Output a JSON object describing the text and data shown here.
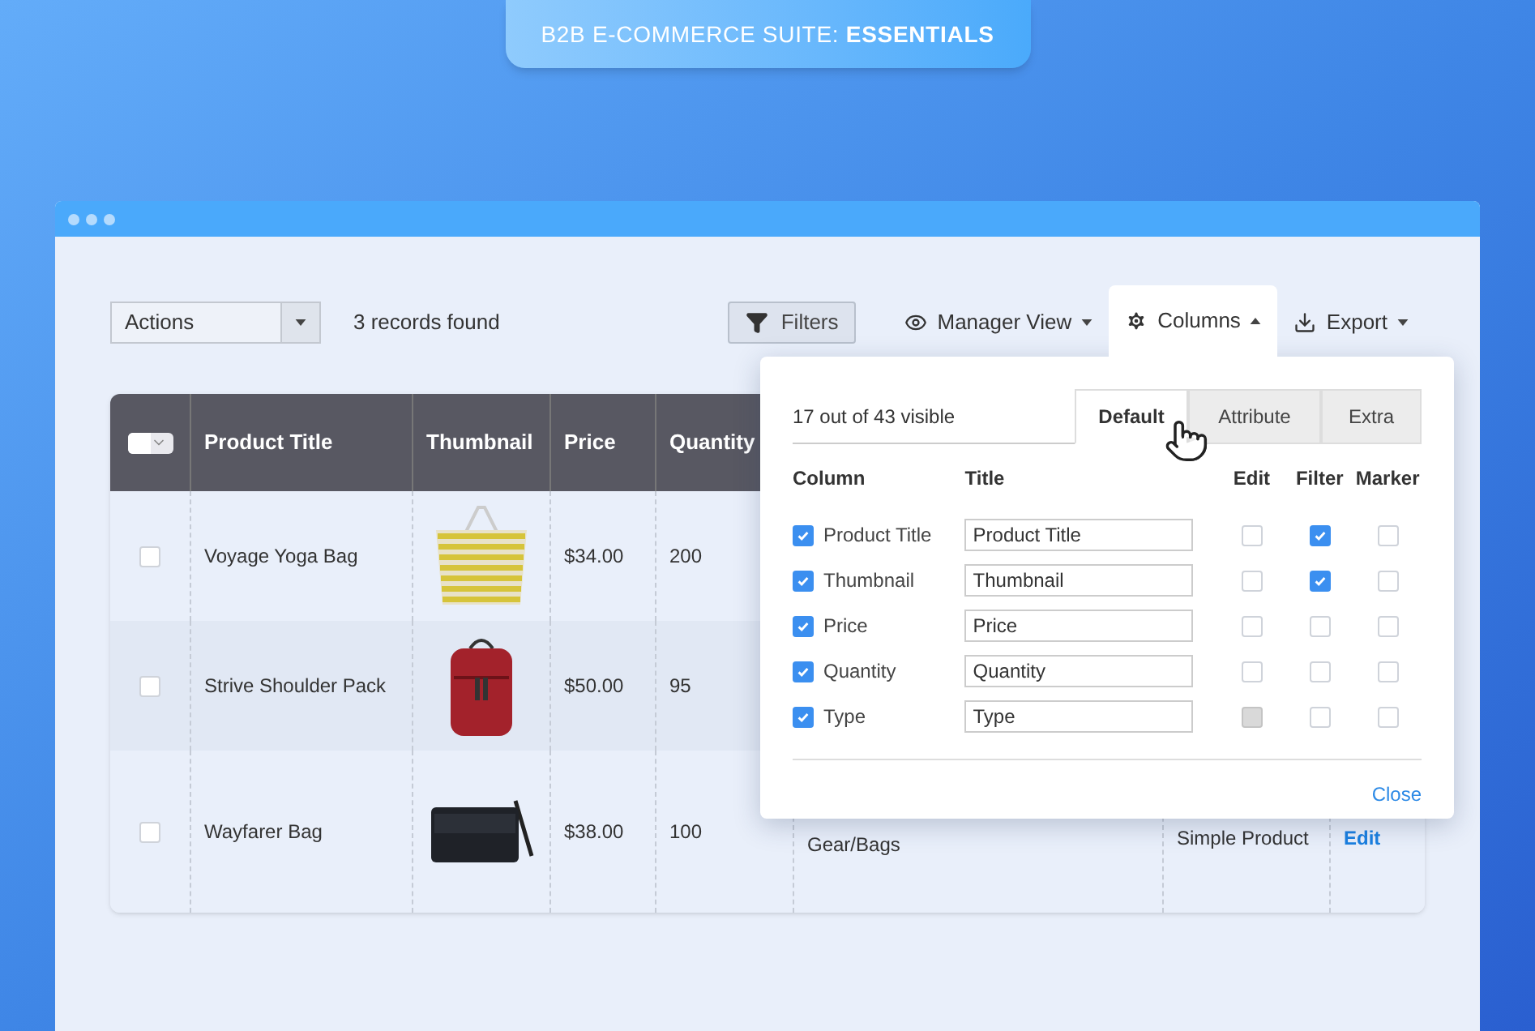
{
  "banner": {
    "text": "B2B E-COMMERCE SUITE: **ESSENTIALS**"
  },
  "toolbar": {
    "actions": {
      "label": "Actions"
    },
    "records": "3 records found",
    "buttons": [
      {
        "kind": "filter",
        "label": "Filters",
        "selected": false
      },
      {
        "kind": "view",
        "label": "Manager View",
        "selected": false
      },
      {
        "kind": "columns",
        "label": "Columns",
        "selected": true
      },
      {
        "kind": "export",
        "label": "Export",
        "selected": false
      }
    ]
  },
  "table": {
    "select_all": {
      "checked": false
    },
    "columns": [
      "Product Title",
      "Thumbnail",
      "Price",
      "Quantity"
    ],
    "rows": [
      {
        "title": "Voyage Yoga Bag",
        "kind": "tote",
        "price": "$34.00",
        "quantity": "200",
        "checked": false
      },
      {
        "title": "Strive Shoulder Pack",
        "kind": "backpack",
        "price": "$50.00",
        "quantity": "95",
        "checked": false
      },
      {
        "title": "Wayfarer Bag",
        "kind": "messenger",
        "price": "$38.00",
        "quantity": "100",
        "checked": false,
        "category": "Gear/Bags",
        "type": "Simple Product",
        "action": "Edit"
      }
    ]
  },
  "columns_panel": {
    "count": "17 out of 43 visible",
    "tabs": [
      {
        "label": "Default",
        "selected": true
      },
      {
        "label": "Attribute",
        "selected": false
      },
      {
        "label": "Extra",
        "selected": false
      }
    ],
    "headers": [
      "Column",
      "Title",
      "Edit",
      "Filter",
      "Marker"
    ],
    "rows": [
      {
        "name": "Product Title",
        "title": "Product Title",
        "visible": true,
        "edit": false,
        "edit_disabled": false,
        "filter": true,
        "marker": false
      },
      {
        "name": "Thumbnail",
        "title": "Thumbnail",
        "visible": true,
        "edit": false,
        "edit_disabled": false,
        "filter": true,
        "marker": false
      },
      {
        "name": "Price",
        "title": "Price",
        "visible": true,
        "edit": false,
        "edit_disabled": false,
        "filter": false,
        "marker": false
      },
      {
        "name": "Quantity",
        "title": "Quantity",
        "visible": true,
        "edit": false,
        "edit_disabled": false,
        "filter": false,
        "marker": false
      },
      {
        "name": "Type",
        "title": "Type",
        "visible": true,
        "edit": false,
        "edit_disabled": true,
        "filter": false,
        "marker": false
      }
    ],
    "close": "Close"
  }
}
